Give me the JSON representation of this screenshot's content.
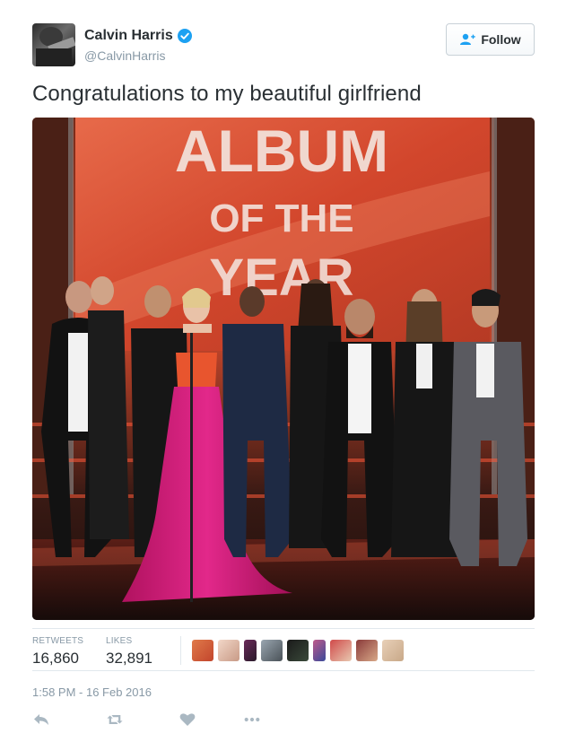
{
  "author": {
    "display_name": "Calvin Harris",
    "handle": "@CalvinHarris",
    "verified": true,
    "verified_color": "#1da1f2"
  },
  "follow_button": {
    "label": "Follow"
  },
  "tweet": {
    "text": "Congratulations to my beautiful girlfriend",
    "media": {
      "type": "photo",
      "sign_text": [
        "ALBUM",
        "OF THE",
        "YEAR"
      ]
    }
  },
  "stats": {
    "retweets_label": "RETWEETS",
    "retweets_value": "16,860",
    "likes_label": "LIKES",
    "likes_value": "32,891",
    "liker_avatar_count": 9
  },
  "timestamp": "1:58 PM - 16 Feb 2016",
  "actions": [
    {
      "name": "reply-icon"
    },
    {
      "name": "retweet-icon"
    },
    {
      "name": "like-icon"
    },
    {
      "name": "more-icon"
    }
  ],
  "colors": {
    "secondary_text": "#8899a6",
    "primary_text": "#292f33",
    "action_icon": "#aab8c2",
    "dress": "#d4197a"
  }
}
